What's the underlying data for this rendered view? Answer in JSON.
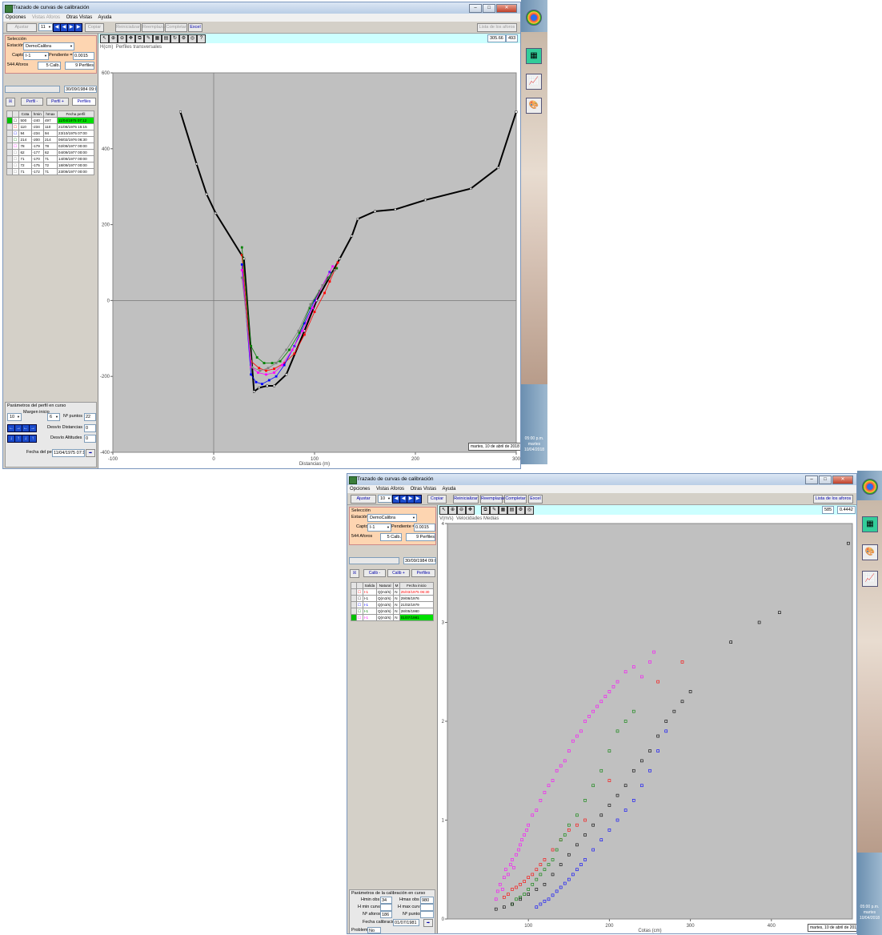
{
  "win1": {
    "title": "Trazado de curvas de calibración",
    "menu": [
      "Opciones",
      "Vistas Aforos",
      "Otras Vistas",
      "Ayuda"
    ],
    "toolbar": {
      "ajustar": "Ajustar",
      "combo": "11",
      "copiar": "Copiar",
      "reinicializar": "Reinicializar",
      "reemplazar": "Reemplazar",
      "completar": "Completar",
      "excel": "Excel",
      "lista": "Lista de los aforos"
    },
    "seleccion": {
      "title": "Selección",
      "estacion_label": "Estación",
      "estacion": "DemoCalibra",
      "captor_label": "Captor",
      "captor": "I-1",
      "pendiente_label": "Pendiente =",
      "pendiente": "0.0015"
    },
    "counts": {
      "aforos": "544 Aforos",
      "calib": "5 Calb.",
      "perfiles": "9 Perfiles"
    },
    "date": "30/09/1984 09:00",
    "tabs": {
      "a": "Perfil -",
      "b": "Perfil +",
      "c": "Perfiles"
    },
    "table": {
      "headers": [
        "Cota",
        "hmin",
        "hmax",
        "Fecha perfil"
      ],
      "rows": [
        {
          "mark": "",
          "cota": "500",
          "hmin": "-240",
          "hmax": "497",
          "fecha": "11/04/1975 07:12",
          "hl": true,
          "color": "#000000"
        },
        {
          "mark": "",
          "cota": "110",
          "hmin": "-234",
          "hmax": "110",
          "fecha": "21/08/1975 15:15",
          "hl": false,
          "color": "#ff0000"
        },
        {
          "mark": "",
          "cota": "94",
          "hmin": "-234",
          "hmax": "94",
          "fecha": "23/10/1975 07:00",
          "hl": false,
          "color": "#0000ff"
        },
        {
          "mark": "",
          "cota": "214",
          "hmin": "-200",
          "hmax": "214",
          "fecha": "06/02/1976 06:30",
          "hl": false,
          "color": "#008000"
        },
        {
          "mark": "",
          "cota": "78",
          "hmin": "-179",
          "hmax": "78",
          "fecha": "02/09/1977 00:00",
          "hl": false,
          "color": "#ff00ff"
        },
        {
          "mark": "",
          "cota": "62",
          "hmin": "-177",
          "hmax": "62",
          "fecha": "04/09/1977 00:00",
          "hl": false,
          "color": "#808080"
        },
        {
          "mark": "",
          "cota": "71",
          "hmin": "-170",
          "hmax": "71",
          "fecha": "14/09/1977 00:00",
          "hl": false,
          "color": "#808080"
        },
        {
          "mark": "",
          "cota": "72",
          "hmin": "-175",
          "hmax": "72",
          "fecha": "18/09/1977 00:00",
          "hl": false,
          "color": "#808080"
        },
        {
          "mark": "",
          "cota": "71",
          "hmin": "-172",
          "hmax": "71",
          "fecha": "23/09/1977 00:00",
          "hl": false,
          "color": "#808080"
        }
      ]
    },
    "params": {
      "title": "Parámetros del perfil en curso",
      "combo": "10",
      "margen_label": "Margen inicio",
      "margen": "6",
      "npuntos_label": "Nº puntos",
      "npuntos": "22",
      "desvio_label": "Desvío Distancias",
      "desvio": "0",
      "desvio_alt_label": "Desvío Altitudes",
      "desvio_alt": "0",
      "fecha_label": "Fecha del perfil",
      "fecha": "11/04/1975 07:12"
    },
    "readout": {
      "x": "305.66",
      "y": "493"
    },
    "status_date": "martes, 10 de abril de 2018"
  },
  "win2": {
    "title": "Trazado de curvas de calibración",
    "menu": [
      "Opciones",
      "Vistas Aforos",
      "Otras Vistas",
      "Ayuda"
    ],
    "toolbar": {
      "ajustar": "Ajustar",
      "combo": "10",
      "copiar": "Copiar",
      "reinicializar": "Reinicializar",
      "reemplazar": "Reemplazar",
      "completar": "Completar",
      "excel": "Excel",
      "lista": "Lista de los aforos"
    },
    "seleccion": {
      "title": "Selección",
      "estacion_label": "Estación",
      "estacion": "DemoCalibra",
      "captor_label": "Captor",
      "captor": "I-1",
      "pendiente_label": "Pendiente =",
      "pendiente": "0.0015"
    },
    "counts": {
      "aforos": "544 Aforos",
      "calib": "5 Calb.",
      "perfiles": "9 Perfiles"
    },
    "date": "30/09/1984 09:00",
    "tabs": {
      "a": "Calib -",
      "b": "Calib +",
      "c": "Perfiles"
    },
    "table": {
      "headers": [
        "Salida",
        "Natural",
        "M",
        "Fecha inicio"
      ],
      "rows": [
        {
          "salida": "I-1",
          "natural": "Q(m3/s)",
          "m": "N",
          "fecha": "25/03/1975 06:30",
          "color": "#ff0000",
          "hl": false
        },
        {
          "salida": "I-1",
          "natural": "Q(m3/s)",
          "m": "N",
          "fecha": "29/06/1976",
          "color": "#000000",
          "hl": false
        },
        {
          "salida": "I-1",
          "natural": "Q(m3/s)",
          "m": "N",
          "fecha": "21/02/1979",
          "color": "#0000ff",
          "hl": false
        },
        {
          "salida": "I-1",
          "natural": "Q(m3/s)",
          "m": "N",
          "fecha": "28/05/1980",
          "color": "#008000",
          "hl": false
        },
        {
          "salida": "I-1",
          "natural": "Q(m3/s)",
          "m": "N",
          "fecha": "01/07/1981",
          "color": "#ff00ff",
          "hl": true
        }
      ]
    },
    "params": {
      "title": "Parámetros de la calibración en curso",
      "hmin_label": "Hmin obs",
      "hmin": "34",
      "hmax_label": "Hmax obs",
      "hmax": "980",
      "hmin_c_label": "H min curva",
      "hmin_c": "",
      "hmax_c_label": "H max curva",
      "hmax_c": "",
      "nafor_label": "Nº aforos",
      "nafor": "186",
      "npun_label": "Nº puntos",
      "npun": "",
      "fecha_label": "Fecha calibración",
      "fecha": "01/07/1981",
      "problema_label": "Problema",
      "problema": "No"
    },
    "readout": {
      "x": "585",
      "y": "0.4442"
    },
    "status_date": "martes, 10 de abril de 2018",
    "clock": [
      "05:00 p.m.",
      "martes",
      "10/04/2018"
    ]
  },
  "chart_data": [
    {
      "type": "line",
      "title": "Perfiles transversales",
      "ylabel": "H(cm)",
      "xlabel": "Distancias (m)",
      "xlim": [
        -100,
        300
      ],
      "ylim": [
        -400,
        600
      ],
      "xticks": [
        -100,
        0,
        100,
        200,
        300
      ],
      "yticks": [
        -400,
        -200,
        0,
        200,
        400,
        600
      ],
      "grid": false,
      "series": [
        {
          "color": "#000000",
          "x": [
            -33,
            -17,
            -7,
            2,
            30,
            40,
            45,
            53,
            60,
            72,
            90,
            102,
            125,
            137,
            143,
            160,
            180,
            210,
            255,
            282,
            300
          ],
          "y": [
            497,
            360,
            280,
            230,
            110,
            -240,
            -230,
            -225,
            -225,
            -195,
            -80,
            0,
            110,
            170,
            215,
            235,
            240,
            265,
            295,
            350,
            497
          ]
        },
        {
          "color": "#ff0000",
          "x": [
            28,
            37,
            45,
            52,
            60,
            70,
            80,
            90,
            100,
            110,
            115,
            120,
            123
          ],
          "y": [
            120,
            -160,
            -178,
            -185,
            -180,
            -165,
            -140,
            -90,
            -30,
            20,
            50,
            80,
            100
          ]
        },
        {
          "color": "#0000ff",
          "x": [
            28,
            37,
            42,
            48,
            55,
            62,
            70,
            80,
            90,
            100,
            108,
            115
          ],
          "y": [
            95,
            -195,
            -215,
            -220,
            -210,
            -200,
            -170,
            -120,
            -60,
            0,
            40,
            75
          ]
        },
        {
          "color": "#008000",
          "x": [
            28,
            37,
            43,
            50,
            58,
            66,
            75,
            85,
            95,
            105,
            113,
            122
          ],
          "y": [
            140,
            -120,
            -150,
            -165,
            -165,
            -160,
            -130,
            -85,
            -20,
            25,
            60,
            85
          ]
        },
        {
          "color": "#ff00ff",
          "x": [
            28,
            37,
            44,
            52,
            60,
            68,
            78,
            88,
            98,
            108,
            118
          ],
          "y": [
            80,
            -175,
            -190,
            -195,
            -190,
            -170,
            -130,
            -80,
            -20,
            40,
            90
          ]
        },
        {
          "color": "#808080",
          "x": [
            28,
            38,
            46,
            54,
            62,
            72,
            84,
            96,
            108,
            120
          ],
          "y": [
            60,
            -176,
            -185,
            -178,
            -165,
            -130,
            -80,
            -10,
            40,
            80
          ]
        }
      ]
    },
    {
      "type": "scatter",
      "title": "Velocidades Medias",
      "ylabel": "V(m/s)",
      "xlabel": "Cotas (cm)",
      "xlim": [
        0,
        500
      ],
      "ylim": [
        0,
        4
      ],
      "xticks": [
        100,
        200,
        300,
        400
      ],
      "yticks": [
        0,
        1,
        2,
        3,
        4
      ],
      "grid": false,
      "series": [
        {
          "color": "#ff00ff",
          "x": [
            60,
            62,
            65,
            68,
            70,
            72,
            75,
            78,
            80,
            82,
            85,
            88,
            90,
            92,
            95,
            98,
            100,
            105,
            110,
            115,
            120,
            125,
            130,
            135,
            140,
            145,
            150,
            155,
            160,
            165,
            170,
            175,
            180,
            185,
            190,
            195,
            200,
            205,
            210,
            220,
            230,
            240,
            250,
            255
          ],
          "y": [
            0.2,
            0.28,
            0.35,
            0.3,
            0.42,
            0.5,
            0.45,
            0.55,
            0.6,
            0.52,
            0.65,
            0.7,
            0.75,
            0.8,
            0.85,
            0.9,
            0.95,
            1.05,
            1.1,
            1.2,
            1.28,
            1.35,
            1.4,
            1.5,
            1.55,
            1.6,
            1.7,
            1.8,
            1.85,
            1.9,
            2.0,
            2.05,
            2.1,
            2.15,
            2.2,
            2.25,
            2.3,
            2.35,
            2.4,
            2.5,
            2.55,
            2.45,
            2.6,
            2.7
          ]
        },
        {
          "color": "#ff0000",
          "x": [
            70,
            75,
            80,
            85,
            90,
            95,
            100,
            105,
            110,
            115,
            120,
            130,
            140,
            150,
            160,
            170,
            200,
            260,
            290
          ],
          "y": [
            0.22,
            0.25,
            0.3,
            0.32,
            0.35,
            0.38,
            0.42,
            0.45,
            0.5,
            0.55,
            0.6,
            0.7,
            0.8,
            0.9,
            0.95,
            1.0,
            1.4,
            2.4,
            2.6
          ]
        },
        {
          "color": "#008000",
          "x": [
            80,
            85,
            90,
            95,
            100,
            105,
            110,
            115,
            120,
            125,
            130,
            135,
            140,
            145,
            150,
            160,
            170,
            180,
            190,
            200,
            210,
            220,
            230
          ],
          "y": [
            0.15,
            0.2,
            0.22,
            0.25,
            0.3,
            0.35,
            0.4,
            0.45,
            0.5,
            0.55,
            0.6,
            0.7,
            0.8,
            0.85,
            0.95,
            1.05,
            1.2,
            1.35,
            1.5,
            1.7,
            1.9,
            2.0,
            2.1
          ]
        },
        {
          "color": "#000000",
          "x": [
            60,
            70,
            80,
            90,
            100,
            110,
            120,
            130,
            140,
            150,
            160,
            170,
            180,
            190,
            200,
            210,
            220,
            230,
            240,
            250,
            260,
            270,
            280,
            290,
            300,
            350,
            385,
            410,
            495
          ],
          "y": [
            0.1,
            0.12,
            0.15,
            0.2,
            0.25,
            0.3,
            0.35,
            0.45,
            0.55,
            0.65,
            0.75,
            0.85,
            0.95,
            1.05,
            1.15,
            1.25,
            1.35,
            1.5,
            1.6,
            1.7,
            1.85,
            2.0,
            2.1,
            2.2,
            2.3,
            2.8,
            3.0,
            3.1,
            3.8
          ]
        },
        {
          "color": "#0000ff",
          "x": [
            110,
            115,
            120,
            125,
            130,
            135,
            140,
            145,
            150,
            155,
            160,
            165,
            170,
            180,
            190,
            200,
            210,
            220,
            230,
            240,
            250,
            260,
            270
          ],
          "y": [
            0.12,
            0.15,
            0.18,
            0.2,
            0.24,
            0.28,
            0.32,
            0.36,
            0.4,
            0.45,
            0.5,
            0.55,
            0.6,
            0.7,
            0.8,
            0.9,
            1.0,
            1.1,
            1.2,
            1.35,
            1.5,
            1.7,
            1.9
          ]
        }
      ]
    }
  ]
}
